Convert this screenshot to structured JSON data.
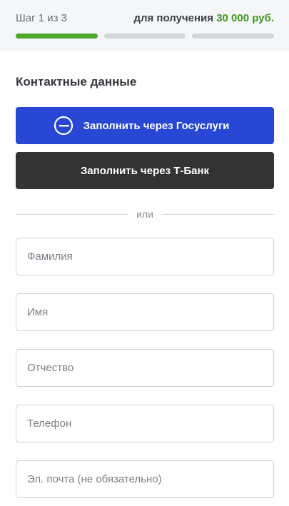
{
  "header": {
    "step_text": "Шаг 1 из 3",
    "amount_prefix": "для получения",
    "amount_value": "30 000 руб.",
    "steps_total": 3,
    "steps_completed": 1
  },
  "form": {
    "section_title": "Контактные данные",
    "gosuslugi_button": "Заполнить через Госуслуги",
    "tbank_button": "Заполнить через Т-Банк",
    "divider_text": "или",
    "fields": {
      "last_name": "Фамилия",
      "first_name": "Имя",
      "patronymic": "Отчество",
      "phone": "Телефон",
      "email": "Эл. почта (не обязательно)"
    }
  },
  "colors": {
    "progress_active": "#4aa72a",
    "amount_accent": "#3f9a1d",
    "gosuslugi_blue": "#2747d4",
    "tbank_dark": "#333333"
  }
}
